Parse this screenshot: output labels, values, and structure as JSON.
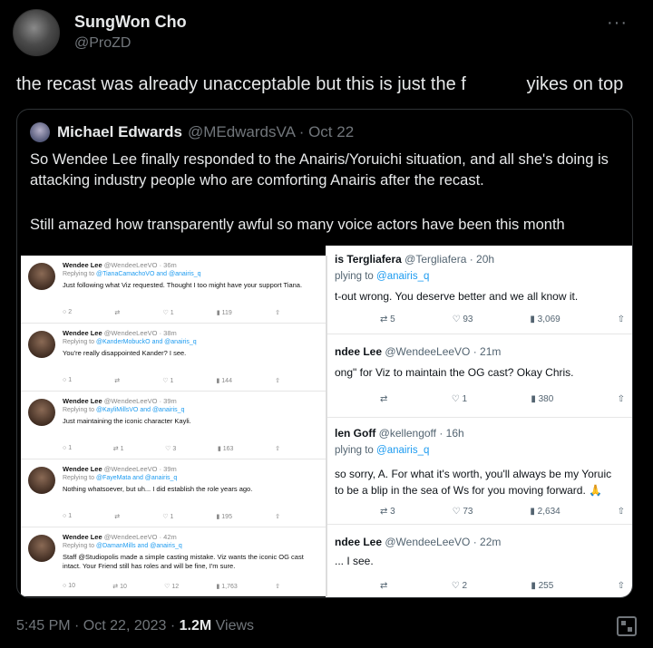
{
  "author": {
    "name": "SungWon Cho",
    "handle": "@ProZD"
  },
  "more_icon": "···",
  "tweet_text": "the recast was already unacceptable but this is just the f            yikes on top",
  "quoted": {
    "name": "Michael Edwards",
    "handle": "@MEdwardsVA · Oct 22",
    "paragraph1": "So Wendee Lee finally responded to the Anairis/Yoruichi situation, and all she's doing is attacking industry people who are comforting Anairis after the recast.",
    "paragraph2": "Still amazed how transparently awful so many voice actors have been this month"
  },
  "left_tweets": [
    {
      "name": "Wendee Lee",
      "meta": "@WendeeLeeVO · 36m",
      "reply_prefix": "Replying to",
      "reply_to": "@TianaCamachoVO and @anairis_q",
      "text": "Just following what Viz requested. Thought I too might have your support Tiana.",
      "stats": [
        "2",
        "",
        "1",
        "119",
        "⇧"
      ]
    },
    {
      "name": "Wendee Lee",
      "meta": "@WendeeLeeVO · 38m",
      "reply_prefix": "Replying to",
      "reply_to": "@KanderMobuckO and @anairis_q",
      "text": "You're really disappointed Kander? I see.",
      "stats": [
        "1",
        "",
        "1",
        "144",
        "⇧"
      ]
    },
    {
      "name": "Wendee Lee",
      "meta": "@WendeeLeeVO · 39m",
      "reply_prefix": "Replying to",
      "reply_to": "@KayliMillsVO and @anairis_q",
      "text": "Just maintaining the iconic character Kayli.",
      "stats": [
        "1",
        "1",
        "3",
        "163",
        "⇧"
      ]
    },
    {
      "name": "Wendee Lee",
      "meta": "@WendeeLeeVO · 39m",
      "reply_prefix": "Replying to",
      "reply_to": "@FayeMata and @anairis_q",
      "text": "Nothing whatsoever, but uh... I did establish the role years ago.",
      "stats": [
        "1",
        "",
        "1",
        "195",
        "⇧"
      ]
    },
    {
      "name": "Wendee Lee",
      "meta": "@WendeeLeeVO · 42m",
      "reply_prefix": "Replying to",
      "reply_to": "@DamanMills and @anairis_q",
      "text": "Staff @Studiopolis made a simple casting mistake. Viz wants the iconic OG cast intact. Your Friend still has roles and will be fine, I'm sure.",
      "stats": [
        "10",
        "10",
        "12",
        "1,763",
        "⇧"
      ]
    }
  ],
  "right_tweets": [
    {
      "name": "is Tergliafera",
      "meta": "@Tergliafera · 20h",
      "reply_prefix": "plying to",
      "reply_to": "@anairis_q",
      "lines": [
        "t-out wrong. You deserve better and we all know it."
      ],
      "stats": [
        "5",
        "93",
        "3,069",
        "⇧"
      ]
    },
    {
      "name": "ndee Lee",
      "meta": "@WendeeLeeVO · 21m",
      "reply_prefix": "",
      "reply_to": "",
      "lines": [
        "ong\" for Viz to maintain the OG cast? Okay Chris."
      ],
      "stats": [
        "",
        "1",
        "380",
        "⇧"
      ]
    },
    {
      "name": "len Goff",
      "meta": "@kellengoff · 16h",
      "reply_prefix": "plying to",
      "reply_to": "@anairis_q",
      "lines": [
        "so sorry, A. For what it's worth, you'll always be my Yoruic",
        "to be a blip in the sea of Ws for you moving forward. 🙏"
      ],
      "stats": [
        "3",
        "73",
        "2,634",
        "⇧"
      ]
    },
    {
      "name": "ndee Lee",
      "meta": "@WendeeLeeVO · 22m",
      "reply_prefix": "",
      "reply_to": "",
      "lines": [
        "... I see."
      ],
      "stats": [
        "",
        "2",
        "255",
        "⇧"
      ]
    }
  ],
  "footer": {
    "time": "5:45 PM · Oct 22, 2023 · ",
    "views_count": "1.2M",
    "views_label": " Views"
  },
  "colors": {
    "background": "#000000",
    "text": "#e7e9ea",
    "muted": "#71767b",
    "link": "#1d9bf0",
    "border": "#2f3336"
  }
}
